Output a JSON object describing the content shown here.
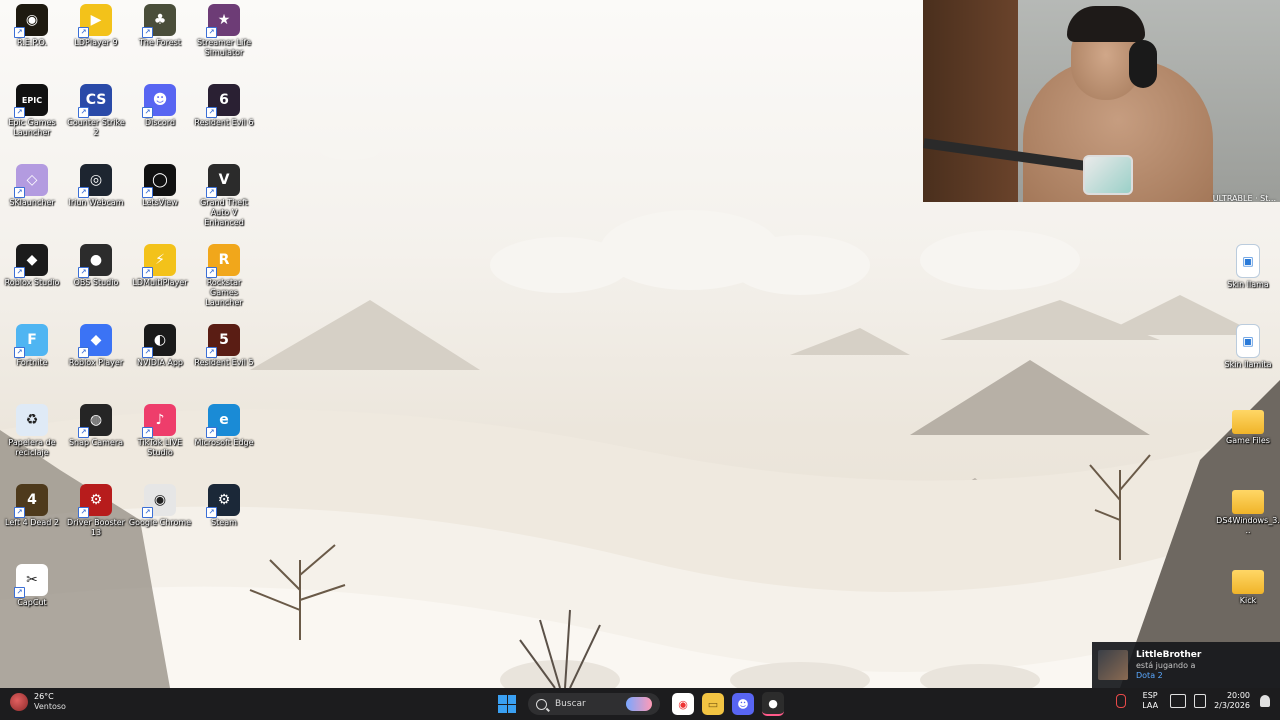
{
  "desktop": {
    "icons": [
      {
        "label": "R.E.P.O.",
        "icon": "repo-icon",
        "color": "#1e1a10",
        "glyph": "◉"
      },
      {
        "label": "LDPlayer 9",
        "icon": "ldplayer-icon",
        "color": "#f3c21a",
        "glyph": "▶"
      },
      {
        "label": "The Forest",
        "icon": "the-forest-icon",
        "color": "#4a4e3a",
        "glyph": "♣"
      },
      {
        "label": "Streamer Life Simulator",
        "icon": "streamer-life-icon",
        "color": "#6d3c76",
        "glyph": "★"
      },
      {
        "label": "Epic Games Launcher",
        "icon": "epic-games-icon",
        "color": "#111111",
        "glyph": "EPIC"
      },
      {
        "label": "Counter Strike 2",
        "icon": "counter-strike-icon",
        "color": "#2a4aa8",
        "glyph": "CS"
      },
      {
        "label": "Discord",
        "icon": "discord-icon",
        "color": "#5865f2",
        "glyph": "☻"
      },
      {
        "label": "Resident Evil 6",
        "icon": "resident-evil-6-icon",
        "color": "#2a2033",
        "glyph": "6"
      },
      {
        "label": "SKlauncher",
        "icon": "sklauncher-icon",
        "color": "#b39be0",
        "glyph": "◇"
      },
      {
        "label": "Iriun Webcam",
        "icon": "iriun-webcam-icon",
        "color": "#1d2530",
        "glyph": "◎"
      },
      {
        "label": "LetsView",
        "icon": "letsview-icon",
        "color": "#111111",
        "glyph": "◯"
      },
      {
        "label": "Grand Theft Auto V Enhanced",
        "icon": "gta-v-icon",
        "color": "#2b2b2b",
        "glyph": "V"
      },
      {
        "label": "Roblox Studio",
        "icon": "roblox-studio-icon",
        "color": "#1b1b1b",
        "glyph": "◆"
      },
      {
        "label": "OBS Studio",
        "icon": "obs-studio-icon",
        "color": "#2c2c2c",
        "glyph": "●"
      },
      {
        "label": "LDMultiPlayer",
        "icon": "ldmultiplayer-icon",
        "color": "#f3c21a",
        "glyph": "⚡"
      },
      {
        "label": "Rockstar Games Launcher",
        "icon": "rockstar-icon",
        "color": "#f1a71b",
        "glyph": "R"
      },
      {
        "label": "Fortnite",
        "icon": "fortnite-icon",
        "color": "#4fb5f2",
        "glyph": "F"
      },
      {
        "label": "Roblox Player",
        "icon": "roblox-player-icon",
        "color": "#3b73f5",
        "glyph": "◆"
      },
      {
        "label": "NVIDIA App",
        "icon": "nvidia-icon",
        "color": "#1a1a1a",
        "glyph": "◐"
      },
      {
        "label": "Resident Evil 5",
        "icon": "resident-evil-5-icon",
        "color": "#5a1d14",
        "glyph": "5"
      },
      {
        "label": "Papelera de reciclaje",
        "icon": "recycle-bin-icon",
        "color": "#dfeaf6",
        "glyph": "♻"
      },
      {
        "label": "Snap Camera",
        "icon": "snap-camera-icon",
        "color": "#252525",
        "glyph": "◍"
      },
      {
        "label": "TikTok LIVE Studio",
        "icon": "tiktok-live-icon",
        "color": "#ee3d6b",
        "glyph": "♪"
      },
      {
        "label": "Microsoft Edge",
        "icon": "edge-icon",
        "color": "#1a8bd6",
        "glyph": "e"
      },
      {
        "label": "Left 4 Dead 2",
        "icon": "left4dead2-icon",
        "color": "#4e3a1c",
        "glyph": "4"
      },
      {
        "label": "Driver Booster 13",
        "icon": "driver-booster-icon",
        "color": "#b71c1c",
        "glyph": "⚙"
      },
      {
        "label": "Google Chrome",
        "icon": "chrome-icon",
        "color": "#e6e6e6",
        "glyph": "◉"
      },
      {
        "label": "Steam",
        "icon": "steam-icon",
        "color": "#1b2838",
        "glyph": "⚙"
      },
      {
        "label": "CapCut",
        "icon": "capcut-icon",
        "color": "#ffffff",
        "glyph": "✂"
      }
    ],
    "right_icons": [
      {
        "label": "Skin llama",
        "icon": "image-file-icon"
      },
      {
        "label": "Skin llamita",
        "icon": "image-file-icon"
      },
      {
        "label": "Game Files",
        "icon": "folder-icon"
      },
      {
        "label": "DS4Windows_3...",
        "icon": "folder-icon"
      },
      {
        "label": "Kick",
        "icon": "folder-icon"
      }
    ]
  },
  "webcam": {
    "overlay_text": "ULTRABLE · St..."
  },
  "notification": {
    "name": "LittleBrother",
    "status": "está jugando a",
    "game": "Dota 2"
  },
  "taskbar": {
    "weather_temp": "26°C",
    "weather_cond": "Ventoso",
    "search_placeholder": "Buscar",
    "lang_top": "ESP",
    "lang_bottom": "LAA",
    "time": "20:00",
    "date": "2/3/2026"
  },
  "colors": {
    "taskbar_bg": "#1c1c1e",
    "accent": "#3aa0f2",
    "notif_link": "#5aa9ff"
  }
}
